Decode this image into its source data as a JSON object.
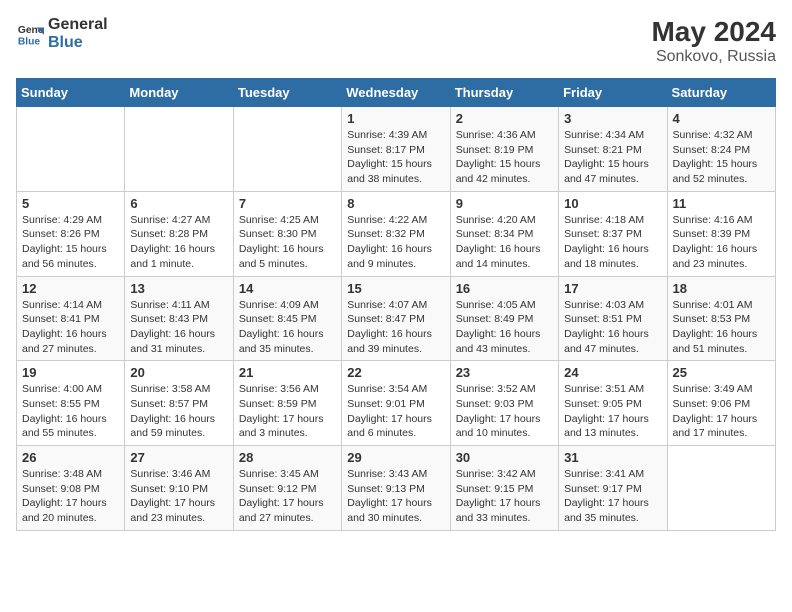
{
  "logo": {
    "line1": "General",
    "line2": "Blue"
  },
  "title": "May 2024",
  "location": "Sonkovo, Russia",
  "days_header": [
    "Sunday",
    "Monday",
    "Tuesday",
    "Wednesday",
    "Thursday",
    "Friday",
    "Saturday"
  ],
  "weeks": [
    [
      {
        "day": "",
        "info": ""
      },
      {
        "day": "",
        "info": ""
      },
      {
        "day": "",
        "info": ""
      },
      {
        "day": "1",
        "info": "Sunrise: 4:39 AM\nSunset: 8:17 PM\nDaylight: 15 hours\nand 38 minutes."
      },
      {
        "day": "2",
        "info": "Sunrise: 4:36 AM\nSunset: 8:19 PM\nDaylight: 15 hours\nand 42 minutes."
      },
      {
        "day": "3",
        "info": "Sunrise: 4:34 AM\nSunset: 8:21 PM\nDaylight: 15 hours\nand 47 minutes."
      },
      {
        "day": "4",
        "info": "Sunrise: 4:32 AM\nSunset: 8:24 PM\nDaylight: 15 hours\nand 52 minutes."
      }
    ],
    [
      {
        "day": "5",
        "info": "Sunrise: 4:29 AM\nSunset: 8:26 PM\nDaylight: 15 hours\nand 56 minutes."
      },
      {
        "day": "6",
        "info": "Sunrise: 4:27 AM\nSunset: 8:28 PM\nDaylight: 16 hours\nand 1 minute."
      },
      {
        "day": "7",
        "info": "Sunrise: 4:25 AM\nSunset: 8:30 PM\nDaylight: 16 hours\nand 5 minutes."
      },
      {
        "day": "8",
        "info": "Sunrise: 4:22 AM\nSunset: 8:32 PM\nDaylight: 16 hours\nand 9 minutes."
      },
      {
        "day": "9",
        "info": "Sunrise: 4:20 AM\nSunset: 8:34 PM\nDaylight: 16 hours\nand 14 minutes."
      },
      {
        "day": "10",
        "info": "Sunrise: 4:18 AM\nSunset: 8:37 PM\nDaylight: 16 hours\nand 18 minutes."
      },
      {
        "day": "11",
        "info": "Sunrise: 4:16 AM\nSunset: 8:39 PM\nDaylight: 16 hours\nand 23 minutes."
      }
    ],
    [
      {
        "day": "12",
        "info": "Sunrise: 4:14 AM\nSunset: 8:41 PM\nDaylight: 16 hours\nand 27 minutes."
      },
      {
        "day": "13",
        "info": "Sunrise: 4:11 AM\nSunset: 8:43 PM\nDaylight: 16 hours\nand 31 minutes."
      },
      {
        "day": "14",
        "info": "Sunrise: 4:09 AM\nSunset: 8:45 PM\nDaylight: 16 hours\nand 35 minutes."
      },
      {
        "day": "15",
        "info": "Sunrise: 4:07 AM\nSunset: 8:47 PM\nDaylight: 16 hours\nand 39 minutes."
      },
      {
        "day": "16",
        "info": "Sunrise: 4:05 AM\nSunset: 8:49 PM\nDaylight: 16 hours\nand 43 minutes."
      },
      {
        "day": "17",
        "info": "Sunrise: 4:03 AM\nSunset: 8:51 PM\nDaylight: 16 hours\nand 47 minutes."
      },
      {
        "day": "18",
        "info": "Sunrise: 4:01 AM\nSunset: 8:53 PM\nDaylight: 16 hours\nand 51 minutes."
      }
    ],
    [
      {
        "day": "19",
        "info": "Sunrise: 4:00 AM\nSunset: 8:55 PM\nDaylight: 16 hours\nand 55 minutes."
      },
      {
        "day": "20",
        "info": "Sunrise: 3:58 AM\nSunset: 8:57 PM\nDaylight: 16 hours\nand 59 minutes."
      },
      {
        "day": "21",
        "info": "Sunrise: 3:56 AM\nSunset: 8:59 PM\nDaylight: 17 hours\nand 3 minutes."
      },
      {
        "day": "22",
        "info": "Sunrise: 3:54 AM\nSunset: 9:01 PM\nDaylight: 17 hours\nand 6 minutes."
      },
      {
        "day": "23",
        "info": "Sunrise: 3:52 AM\nSunset: 9:03 PM\nDaylight: 17 hours\nand 10 minutes."
      },
      {
        "day": "24",
        "info": "Sunrise: 3:51 AM\nSunset: 9:05 PM\nDaylight: 17 hours\nand 13 minutes."
      },
      {
        "day": "25",
        "info": "Sunrise: 3:49 AM\nSunset: 9:06 PM\nDaylight: 17 hours\nand 17 minutes."
      }
    ],
    [
      {
        "day": "26",
        "info": "Sunrise: 3:48 AM\nSunset: 9:08 PM\nDaylight: 17 hours\nand 20 minutes."
      },
      {
        "day": "27",
        "info": "Sunrise: 3:46 AM\nSunset: 9:10 PM\nDaylight: 17 hours\nand 23 minutes."
      },
      {
        "day": "28",
        "info": "Sunrise: 3:45 AM\nSunset: 9:12 PM\nDaylight: 17 hours\nand 27 minutes."
      },
      {
        "day": "29",
        "info": "Sunrise: 3:43 AM\nSunset: 9:13 PM\nDaylight: 17 hours\nand 30 minutes."
      },
      {
        "day": "30",
        "info": "Sunrise: 3:42 AM\nSunset: 9:15 PM\nDaylight: 17 hours\nand 33 minutes."
      },
      {
        "day": "31",
        "info": "Sunrise: 3:41 AM\nSunset: 9:17 PM\nDaylight: 17 hours\nand 35 minutes."
      },
      {
        "day": "",
        "info": ""
      }
    ]
  ]
}
